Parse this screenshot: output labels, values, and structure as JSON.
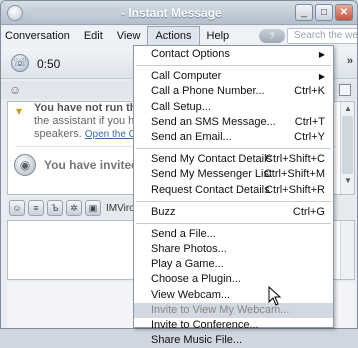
{
  "window": {
    "title": "- Instant Message",
    "controls": {
      "minimize": "_",
      "maximize": "□",
      "close": "✕"
    }
  },
  "menubar": {
    "items": [
      {
        "label": "Conversation"
      },
      {
        "label": "Edit"
      },
      {
        "label": "View"
      },
      {
        "label": "Actions"
      },
      {
        "label": "Help"
      }
    ],
    "help_icon": "?",
    "search_placeholder": "Search the web"
  },
  "call": {
    "time": "0:50",
    "expand": "»"
  },
  "conversation": {
    "warning_line1": "You have not run the",
    "warning_line2": "the assistant if you have",
    "warning_line3_prefix": "speakers.",
    "warning_link": "Open the Cal",
    "invite_text": "You have invited m"
  },
  "toolbar": {
    "label": "IMVironment"
  },
  "actions_menu": {
    "groups": [
      [
        {
          "label": "Contact Options",
          "shortcut": "",
          "submenu": true
        }
      ],
      [
        {
          "label": "Call Computer",
          "shortcut": "",
          "submenu": true
        },
        {
          "label": "Call a Phone Number...",
          "shortcut": "Ctrl+K",
          "submenu": false
        },
        {
          "label": "Call Setup...",
          "shortcut": "",
          "submenu": false
        },
        {
          "label": "Send an SMS Message...",
          "shortcut": "Ctrl+T",
          "submenu": false
        },
        {
          "label": "Send an Email...",
          "shortcut": "Ctrl+Y",
          "submenu": false
        }
      ],
      [
        {
          "label": "Send My Contact Details",
          "shortcut": "Ctrl+Shift+C",
          "submenu": false
        },
        {
          "label": "Send My Messenger List",
          "shortcut": "Ctrl+Shift+M",
          "submenu": false
        },
        {
          "label": "Request Contact Details",
          "shortcut": "Ctrl+Shift+R",
          "submenu": false
        }
      ],
      [
        {
          "label": "Buzz",
          "shortcut": "Ctrl+G",
          "submenu": false
        }
      ],
      [
        {
          "label": "Send a File...",
          "shortcut": "",
          "submenu": false
        },
        {
          "label": "Share Photos...",
          "shortcut": "",
          "submenu": false
        },
        {
          "label": "Play a Game...",
          "shortcut": "",
          "submenu": false
        },
        {
          "label": "Choose a Plugin...",
          "shortcut": "",
          "submenu": false
        },
        {
          "label": "View Webcam...",
          "shortcut": "",
          "submenu": false
        },
        {
          "label": "Invite to View My Webcam...",
          "shortcut": "",
          "submenu": false,
          "highlighted": true
        },
        {
          "label": "Invite to Conference...",
          "shortcut": "",
          "submenu": false
        },
        {
          "label": "Share Music File...",
          "shortcut": "",
          "submenu": false
        }
      ]
    ]
  }
}
